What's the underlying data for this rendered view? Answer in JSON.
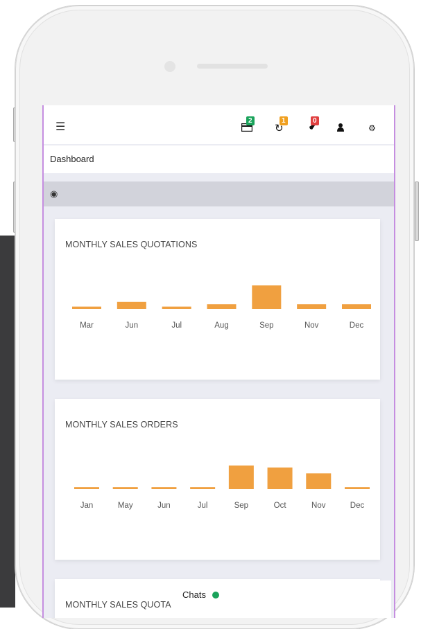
{
  "colors": {
    "bar": "#f0a040",
    "accent_border": "#c58ee0",
    "online": "#1aa35b"
  },
  "topbar": {
    "menu_icon": "hamburger-icon",
    "icons": [
      {
        "name": "card-icon",
        "badge": "2",
        "badge_color": "#1aa35b"
      },
      {
        "name": "refresh-icon",
        "badge": "1",
        "badge_color": "#f0a020"
      },
      {
        "name": "rocket-icon",
        "badge": "0",
        "badge_color": "#e04040"
      },
      {
        "name": "user-icon"
      },
      {
        "name": "gears-icon"
      }
    ]
  },
  "breadcrumb": {
    "label": "Dashboard"
  },
  "toolbar": {
    "icon": "life-ring-icon"
  },
  "cards": [
    {
      "title": "MONTHLY SALES QUOTATIONS"
    },
    {
      "title": "MONTHLY SALES ORDERS"
    },
    {
      "title": "MONTHLY SALES QUOTA"
    }
  ],
  "chart_data": [
    {
      "type": "bar",
      "title": "MONTHLY SALES QUOTATIONS",
      "categories": [
        "Mar",
        "Jun",
        "Jul",
        "Aug",
        "Sep",
        "Nov",
        "Dec"
      ],
      "values": [
        1,
        3,
        1,
        2,
        10,
        2,
        2
      ]
    },
    {
      "type": "bar",
      "title": "MONTHLY SALES ORDERS",
      "categories": [
        "Jan",
        "May",
        "Jun",
        "Jul",
        "Sep",
        "Oct",
        "Nov",
        "Dec"
      ],
      "values": [
        1,
        1,
        1,
        1,
        12,
        11,
        8,
        1
      ]
    }
  ],
  "chat": {
    "label": "Chats"
  }
}
